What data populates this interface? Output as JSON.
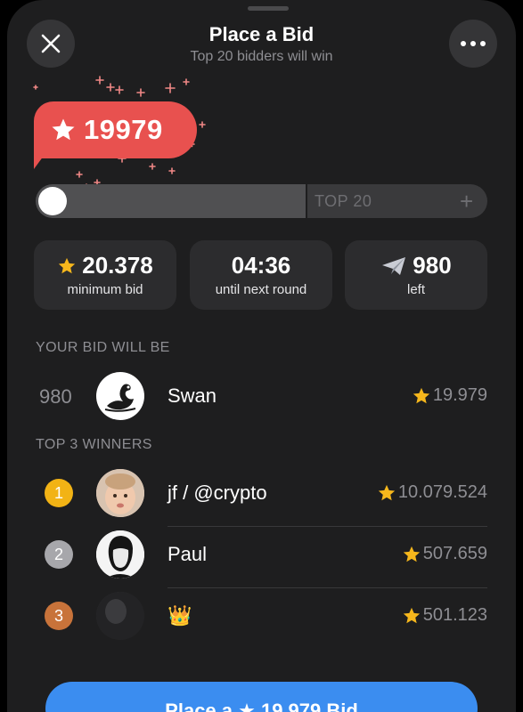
{
  "header": {
    "title": "Place a Bid",
    "subtitle": "Top 20 bidders will win"
  },
  "bid": {
    "amount": "19979",
    "slider_label": "TOP 20",
    "slider_position": 0
  },
  "stats": [
    {
      "value": "20.378",
      "label": "minimum bid",
      "icon": "star-icon"
    },
    {
      "value": "04:36",
      "label": "until next round",
      "icon": ""
    },
    {
      "value": "980",
      "label": "left",
      "icon": "paper-plane-icon"
    }
  ],
  "your_bid": {
    "section_title": "YOUR BID WILL BE",
    "rank": "980",
    "name": "Swan",
    "amount": "19.979"
  },
  "winners": {
    "section_title": "TOP 3 WINNERS",
    "rows": [
      {
        "rank": "1",
        "name": "jf / @crypto",
        "amount": "10.079.524",
        "badge_color": "#f2b315"
      },
      {
        "rank": "2",
        "name": "Paul",
        "amount": "507.659",
        "badge_color": "#a7a7ab"
      },
      {
        "rank": "3",
        "name": "👑",
        "amount": "501.123",
        "badge_color": "#c8733a"
      }
    ]
  },
  "cta": {
    "label": "Place a ★ 19.979 Bid"
  },
  "colors": {
    "bubble": "#e8514f",
    "accent_button": "#3b8df0",
    "star": "#f6b71c"
  }
}
